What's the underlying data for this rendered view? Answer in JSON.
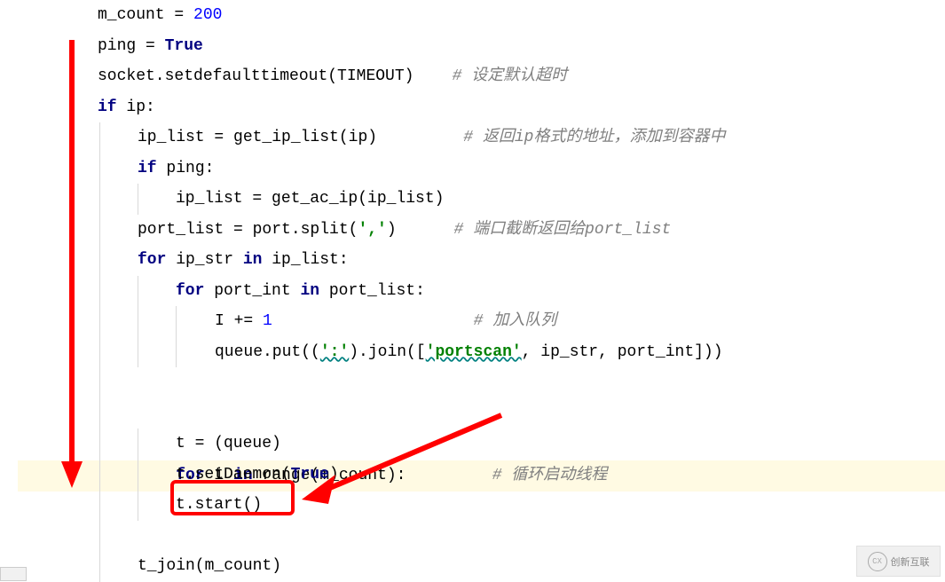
{
  "code": {
    "line1_a": "m_count = ",
    "line1_num": "200",
    "line2_a": "ping = ",
    "line2_kw": "True",
    "line3_a": "socket.setdefaulttimeout(TIMEOUT)    ",
    "line3_c": "# 设定默认超时",
    "line4_if": "if",
    "line4_b": " ip:",
    "line5_a": "ip_list = get_ip_list(ip)         ",
    "line5_c": "# 返回ip格式的地址，添加到容器中",
    "line6_if": "if",
    "line6_b": " ping:",
    "line7_a": "ip_list = get_ac_ip(ip_list)",
    "line8_a": "port_list = port.split(",
    "line8_str": "','",
    "line8_b": ")      ",
    "line8_c": "# 端口截断返回给port_list",
    "line9_for": "for",
    "line9_a": " ip_str ",
    "line9_in": "in",
    "line9_b": " ip_list:",
    "line10_for": "for",
    "line10_a": " port_int ",
    "line10_in": "in",
    "line10_b": " port_list:",
    "line11_a": "I += ",
    "line11_num": "1",
    "line11_pad": "                     ",
    "line11_c": "# 加入队列",
    "line12_a": "queue.put((",
    "line12_str1": "':'",
    "line12_b": ").join([",
    "line12_str2": "'portscan'",
    "line12_c": ", ip_str, port_int]))",
    "line14_for": "for",
    "line14_a": " i ",
    "line14_in": "in",
    "line14_b": " range(m_count):         ",
    "line14_c": "# 循环启动线程",
    "line15_a": "t = (queue)",
    "line16_a": "t.setDaemon(",
    "line16_kw": "True",
    "line16_b": ")",
    "line17_a": "t.start()",
    "line19_a": "t_join(m_count)"
  },
  "watermark": "创新互联",
  "watermark_icon": "CX"
}
